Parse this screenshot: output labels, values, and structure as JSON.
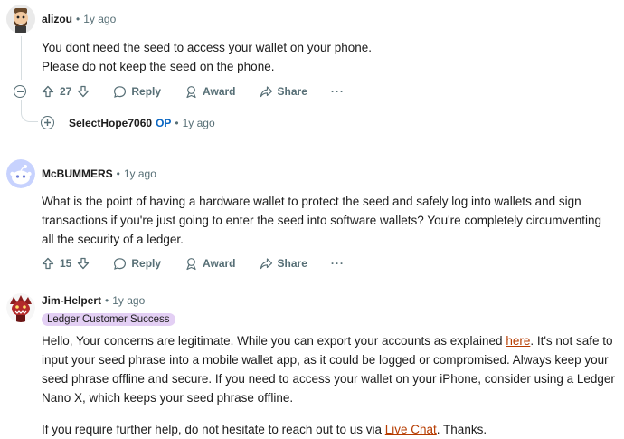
{
  "comments": [
    {
      "username": "alizou",
      "time": "1y ago",
      "lines": [
        "You dont need the seed to access your wallet on your phone.",
        "Please do not keep the seed on the phone."
      ],
      "score": "27",
      "reply": "Reply",
      "award": "Award",
      "share": "Share",
      "more": "···"
    },
    {
      "username": "McBUMMERS",
      "time": "1y ago",
      "lines": [
        "What is the point of having a hardware wallet to protect the seed and safely log into wallets and sign",
        "transactions if you're just going to enter the seed into software wallets? You're completely circumventing",
        "all the security of a ledger."
      ],
      "score": "15",
      "reply": "Reply",
      "award": "Award",
      "share": "Share",
      "more": "···"
    },
    {
      "username": "Jim-Helpert",
      "time": "1y ago",
      "flair": "Ledger Customer Success",
      "p1_lines": [
        "Hello, Your concerns are legitimate. While you can export your accounts as explained",
        "here",
        ". It's not safe to",
        "input your seed phrase into a mobile wallet app, as it could be logged or compromised. Always keep your",
        "seed phrase offline and secure. If you need to access your wallet on your iPhone, consider using a Ledger",
        "Nano X, which keeps your seed phrase offline."
      ],
      "p2_before": "If you require further help, do not hesitate to reach out to us via",
      "p2_link": "Live Chat",
      "p2_after": ". Thanks."
    }
  ],
  "collapsed_reply": {
    "username": "SelectHope7060",
    "op": "OP",
    "time": "1y ago"
  },
  "separator": "•"
}
